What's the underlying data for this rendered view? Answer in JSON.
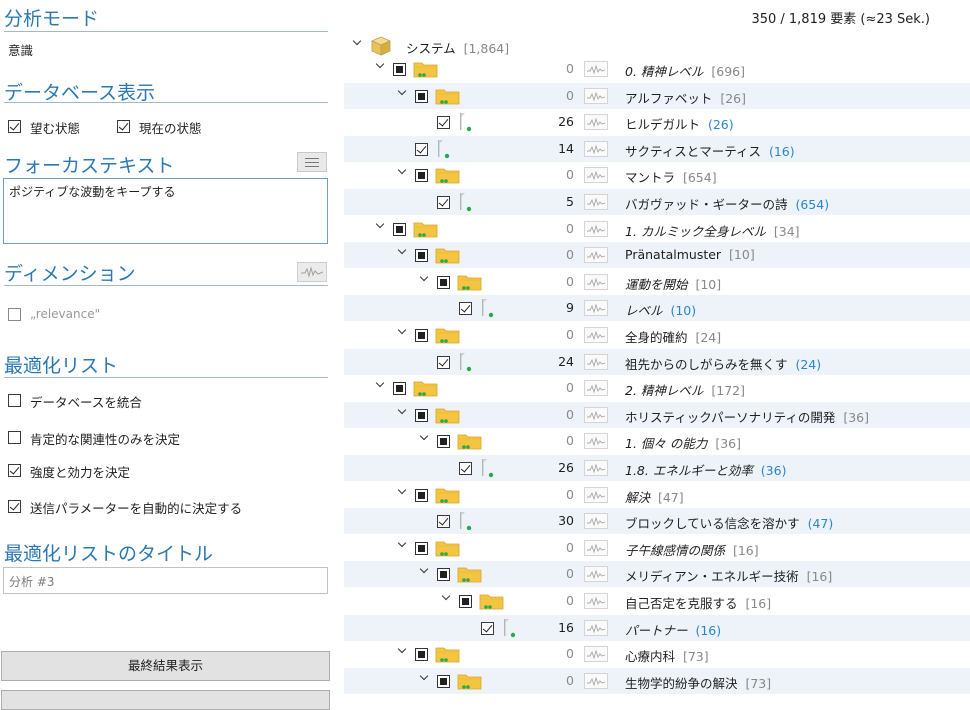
{
  "left": {
    "analysis_mode": {
      "title": "分析モード",
      "value": "意識"
    },
    "db_display": {
      "title": "データベース表示",
      "desired": "望む状態",
      "current": "現在の状態"
    },
    "focus_text": {
      "title": "フォーカステキスト",
      "value": "ポジティブな波動をキープする"
    },
    "dimension": {
      "title": "ディメンション",
      "relevance": "„relevance\""
    },
    "opt_list": {
      "title": "最適化リスト",
      "items": [
        {
          "label": "データベースを統合",
          "checked": false
        },
        {
          "label": "肯定的な関連性のみを決定",
          "checked": false
        },
        {
          "label": "強度と効力を決定",
          "checked": true
        },
        {
          "label": "送信パラメーターを自動的に決定する",
          "checked": true
        }
      ]
    },
    "opt_title": {
      "title": "最適化リストのタイトル",
      "placeholder": "分析 #3"
    },
    "final_button": "最終結果表示"
  },
  "header": {
    "count": "350 / 1,819 要素 (≈23 Sek.)"
  },
  "tree": {
    "root": {
      "label": "システム",
      "count": "[1,864]"
    },
    "rows": [
      {
        "kind": "folder",
        "indent": 0,
        "num": "0",
        "label": "0. 精神レベル",
        "count": "[696]",
        "italic": true
      },
      {
        "kind": "folder",
        "indent": 1,
        "num": "0",
        "label": "アルファベット",
        "count": "[26]",
        "italic": false
      },
      {
        "kind": "leaf",
        "indent": 2,
        "num": "26",
        "label": "ヒルデガルト",
        "count": "(26)",
        "italic": false
      },
      {
        "kind": "leaf",
        "indent": 1,
        "num": "14",
        "label": "サクティスとマーティス",
        "count": "(16)",
        "italic": false
      },
      {
        "kind": "folder",
        "indent": 1,
        "num": "0",
        "label": "マントラ",
        "count": "[654]",
        "italic": false
      },
      {
        "kind": "leaf",
        "indent": 2,
        "num": "5",
        "label": "バガヴァッド・ギーターの詩",
        "count": "(654)",
        "italic": false
      },
      {
        "kind": "folder",
        "indent": 0,
        "num": "0",
        "label": "1. カルミック全身レベル",
        "count": "[34]",
        "italic": true
      },
      {
        "kind": "folder",
        "indent": 1,
        "num": "0",
        "label": "Pränatalmuster",
        "count": "[10]",
        "italic": false
      },
      {
        "kind": "folder",
        "indent": 2,
        "num": "0",
        "label": "運動を開始",
        "count": "[10]",
        "italic": true
      },
      {
        "kind": "leaf",
        "indent": 3,
        "num": "9",
        "label": "レベル",
        "count": "(10)",
        "italic": true
      },
      {
        "kind": "folder",
        "indent": 1,
        "num": "0",
        "label": "全身的確約",
        "count": "[24]",
        "italic": false
      },
      {
        "kind": "leaf",
        "indent": 2,
        "num": "24",
        "label": "祖先からのしがらみを無くす",
        "count": "(24)",
        "italic": false
      },
      {
        "kind": "folder",
        "indent": 0,
        "num": "0",
        "label": "2. 精神レベル",
        "count": "[172]",
        "italic": true
      },
      {
        "kind": "folder",
        "indent": 1,
        "num": "0",
        "label": "ホリスティックパーソナリティの開発",
        "count": "[36]",
        "italic": false
      },
      {
        "kind": "folder",
        "indent": 2,
        "num": "0",
        "label": "1. 個々 の能力",
        "count": "[36]",
        "italic": true
      },
      {
        "kind": "leaf",
        "indent": 3,
        "num": "26",
        "label": "1.8. エネルギーと効率",
        "count": "(36)",
        "italic": true
      },
      {
        "kind": "folder",
        "indent": 1,
        "num": "0",
        "label": "解決",
        "count": "[47]",
        "italic": true
      },
      {
        "kind": "leaf",
        "indent": 2,
        "num": "30",
        "label": "ブロックしている信念を溶かす",
        "count": "(47)",
        "italic": false
      },
      {
        "kind": "folder",
        "indent": 1,
        "num": "0",
        "label": "子午線感情の関係",
        "count": "[16]",
        "italic": true
      },
      {
        "kind": "folder",
        "indent": 2,
        "num": "0",
        "label": "メリディアン・エネルギー技術",
        "count": "[16]",
        "italic": false
      },
      {
        "kind": "folder",
        "indent": 3,
        "num": "0",
        "label": "自己否定を克服する",
        "count": "[16]",
        "italic": false
      },
      {
        "kind": "leaf",
        "indent": 4,
        "num": "16",
        "label": "パートナー",
        "count": "(16)",
        "italic": true
      },
      {
        "kind": "folder",
        "indent": 1,
        "num": "0",
        "label": "心療内科",
        "count": "[73]",
        "italic": false
      },
      {
        "kind": "folder",
        "indent": 2,
        "num": "0",
        "label": "生物学的紛争の解決",
        "count": "[73]",
        "italic": false
      }
    ]
  },
  "colors": {
    "accent": "#2b78b5",
    "count_blue": "#2a86d5",
    "folder": "#f5c542",
    "row_alt": "#eef3f9"
  },
  "icons": {
    "chevron": "chevron-down-icon",
    "folder": "folder-icon",
    "leaf": "document-leaf-icon",
    "wave": "waveform-icon",
    "cube": "cube-icon"
  }
}
